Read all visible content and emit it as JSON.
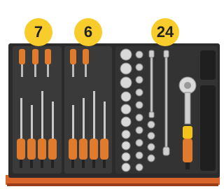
{
  "badges": [
    {
      "label": "7"
    },
    {
      "label": "6"
    },
    {
      "label": "24"
    }
  ],
  "colors": {
    "badge": "#f7cc2b",
    "foam": "#2b2b2b",
    "tray_edge": "#e0722a",
    "tool_handle": "#e07a2c"
  }
}
